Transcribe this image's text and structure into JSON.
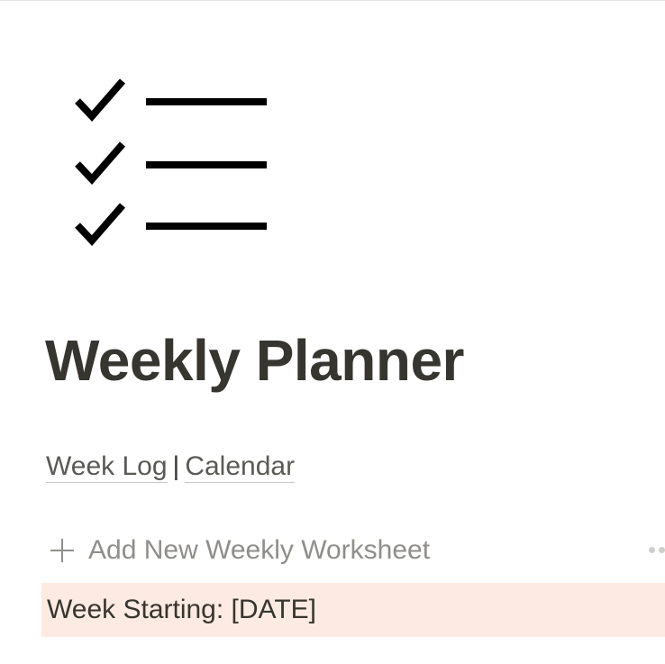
{
  "page": {
    "icon": "checklist-icon",
    "title": "Weekly Planner"
  },
  "nav": {
    "links": [
      "Week Log",
      "Calendar"
    ],
    "separator": "|"
  },
  "database": {
    "add_label": "Add New Weekly Worksheet",
    "add_icon": "plus-icon",
    "more_icon": "more-dots-icon",
    "rows": [
      {
        "title": "Week Starting: [DATE]"
      }
    ],
    "row_highlight_color": "#fdebe3"
  },
  "colors": {
    "text": "#37352f",
    "muted": "#8f8e8a"
  }
}
